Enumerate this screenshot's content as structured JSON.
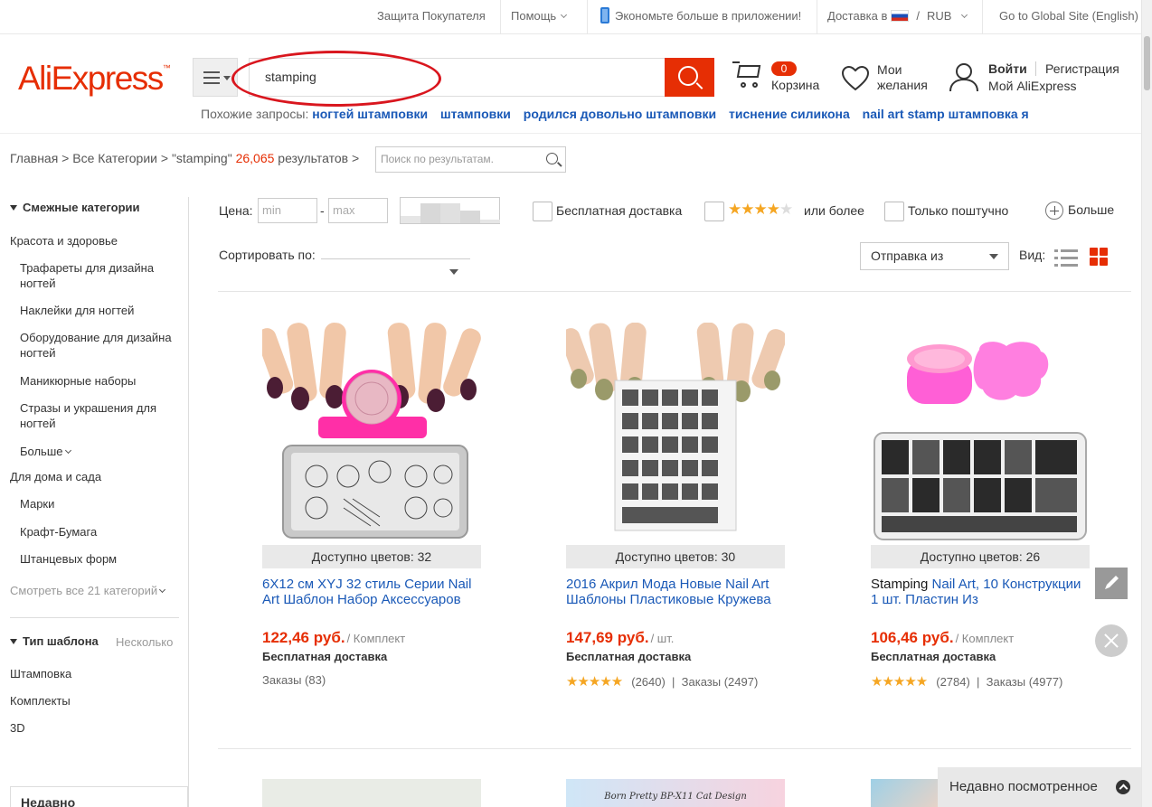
{
  "topbar": {
    "buyer_protection": "Защита Покупателя",
    "help": "Помощь",
    "app_promo": "Экономьте больше в приложении!",
    "ship_to": "Доставка в",
    "currency": "RUB",
    "global_site": "Go to Global Site (English)"
  },
  "header": {
    "logo": "AliExpress",
    "search_value": "stamping",
    "cart_count": "0",
    "cart_label": "Корзина",
    "wish_label": "Мои желания",
    "login": "Войти",
    "register": "Регистрация",
    "my_ali": "Мой AliExpress",
    "related_label": "Похожие запросы:",
    "related": [
      "ногтей штамповки",
      "штамповки",
      "родился довольно штамповки",
      "тиснение силикона",
      "nail art stamp штамповка я"
    ]
  },
  "breadcrumb": {
    "home": "Главная",
    "all_categories": "Все Категории",
    "query": "\"stamping\"",
    "count": "26,065",
    "results": "результатов",
    "refine_placeholder": "Поиск по результатам."
  },
  "sidebar": {
    "related_categories": "Смежные категории",
    "cat1": "Красота и здоровье",
    "cat1_items": [
      "Трафареты для дизайна ногтей",
      "Наклейки для ногтей",
      "Оборудование для дизайна ногтей",
      "Маникюрные наборы",
      "Стразы и украшения для ногтей"
    ],
    "more": "Больше",
    "cat2": "Для дома и сада",
    "cat2_items": [
      "Марки",
      "Крафт-Бумага",
      "Штанцевых форм"
    ],
    "see_all": "Смотреть все 21 категорий",
    "template_type": "Тип шаблона",
    "template_multi": "Несколько",
    "template_items": [
      "Штамповка",
      "Комплекты",
      "3D"
    ],
    "recently": "Недавно"
  },
  "filters": {
    "price_label": "Цена:",
    "min_placeholder": "min",
    "max_placeholder": "max",
    "dash": "-",
    "free_shipping": "Бесплатная доставка",
    "rating_more": "или более",
    "single_piece": "Только поштучно",
    "more": "Больше",
    "sort_by": "Сортировать по:",
    "ship_from": "Отправка из",
    "view": "Вид:"
  },
  "products": [
    {
      "colors": "Доступно цветов: 32",
      "title_strong": "",
      "title": "6X12 см XYJ 32 стиль Серии Nail Art Шаблон Набор Аксессуаров",
      "price": "122,46 руб.",
      "unit": "/ Комплект",
      "shipping": "Бесплатная доставка",
      "rating_count": "",
      "orders": "Заказы (83)"
    },
    {
      "colors": "Доступно цветов: 30",
      "title_strong": "",
      "title": "2016 Акрил Мода Новые Nail Art Шаблоны Пластиковые Кружева",
      "price": "147,69 руб.",
      "unit": "/ шт.",
      "shipping": "Бесплатная доставка",
      "rating_count": "(2640)",
      "orders": "Заказы (2497)"
    },
    {
      "colors": "Доступно цветов: 26",
      "title_strong": "Stamping",
      "title": " Nail Art, 10 Конструкции 1 шт. Пластин Из",
      "price": "106,46 руб.",
      "unit": "/ Комплект",
      "shipping": "Бесплатная доставка",
      "rating_count": "(2784)",
      "orders": "Заказы (4977)"
    }
  ],
  "thumb2_text": "Born Pretty  BP-X11 Cat Design",
  "recently_viewed": "Недавно посмотренное",
  "colors": {
    "accent": "#e62e04",
    "link": "#1a59b7",
    "star": "#f5a623",
    "annotation": "#d9161e"
  },
  "icons": [
    "menu-icon",
    "search-icon",
    "cart-icon",
    "heart-icon",
    "user-icon",
    "phone-icon",
    "flag-icon",
    "list-view-icon",
    "grid-view-icon",
    "plus-icon",
    "edit-icon",
    "close-icon",
    "chevron-up-icon"
  ]
}
